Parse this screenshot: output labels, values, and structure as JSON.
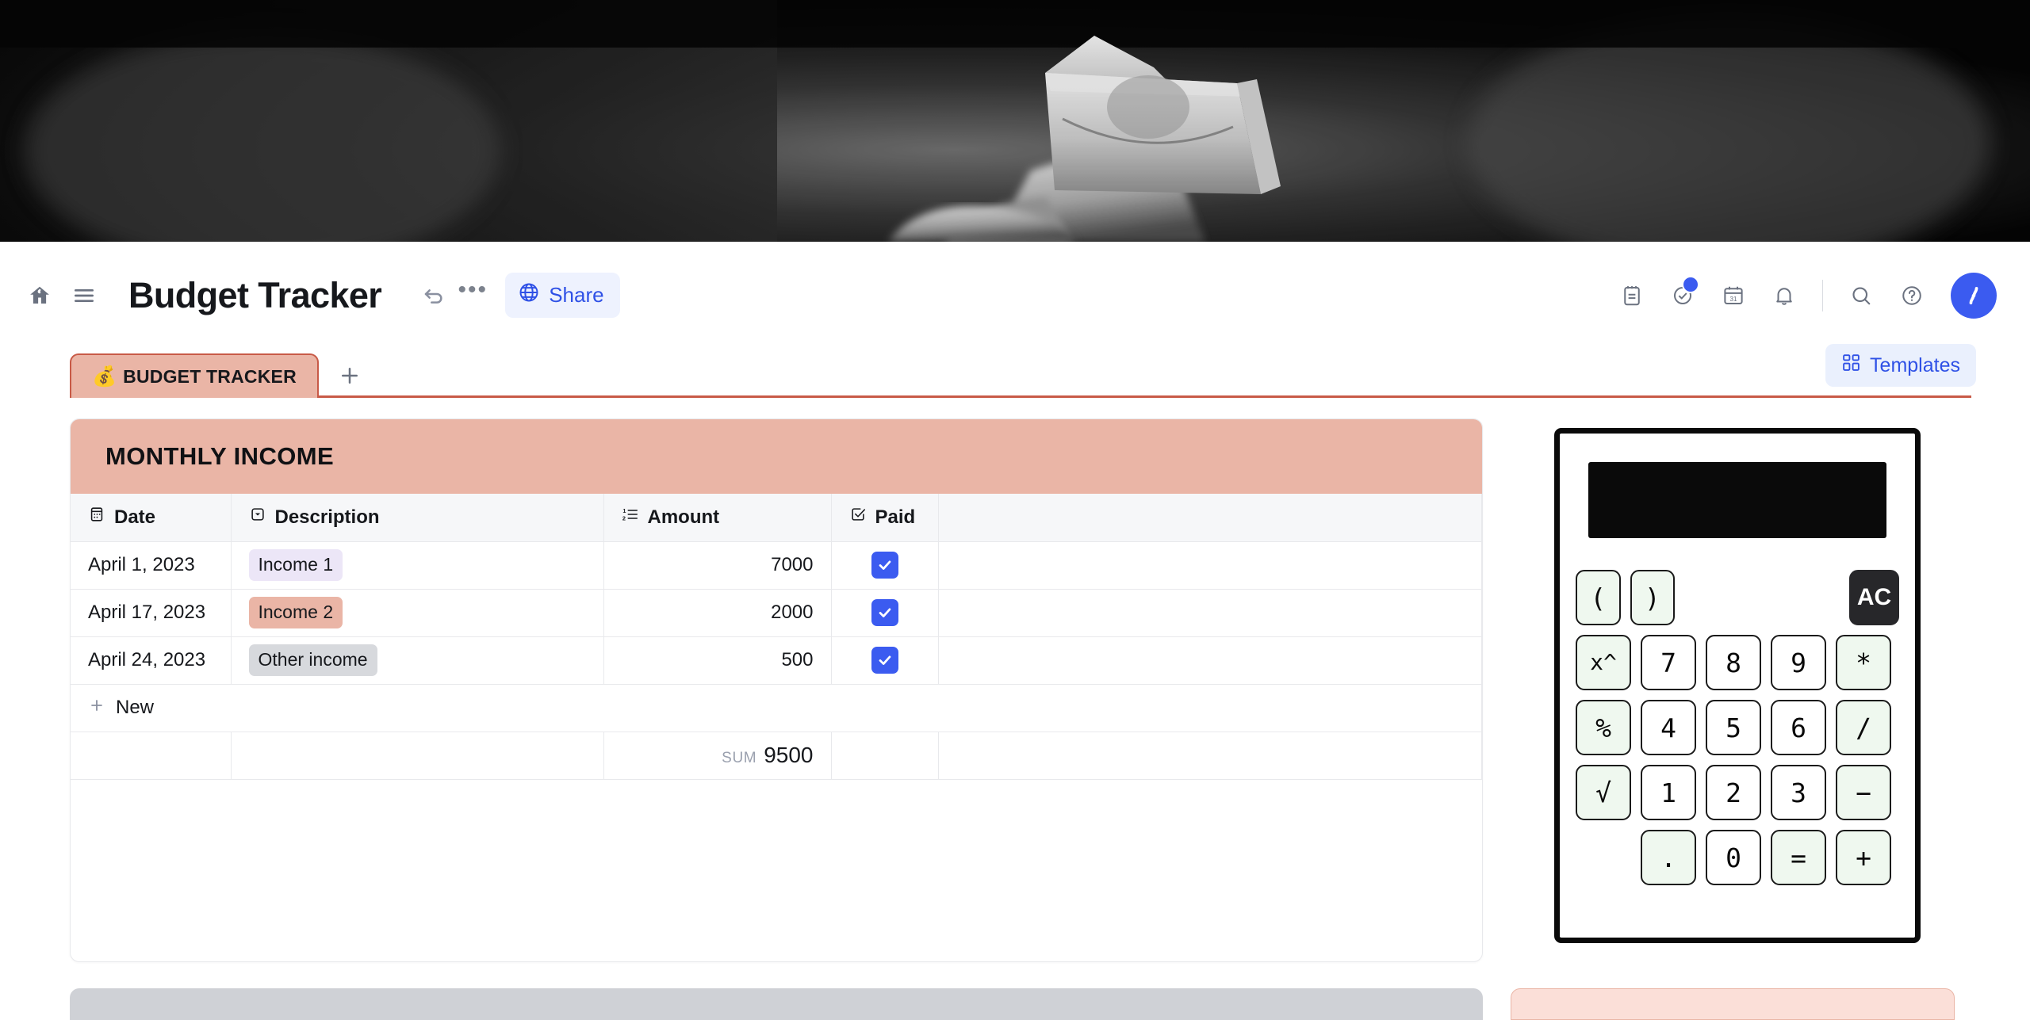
{
  "hero": {
    "alt": "hand-holding-folded-dollar-bill-black-and-white"
  },
  "header": {
    "title": "Budget Tracker",
    "home_icon": "home-icon",
    "menu_icon": "hamburger-menu-icon",
    "undo_icon": "undo-icon",
    "more_label": "•••",
    "share_label": "Share",
    "icons": [
      {
        "name": "notepad-icon",
        "badge": false
      },
      {
        "name": "check-circle-icon",
        "badge": true
      },
      {
        "name": "calendar-icon",
        "badge": false,
        "day": "31"
      },
      {
        "name": "bell-icon",
        "badge": false
      },
      {
        "name": "search-icon",
        "badge": false
      },
      {
        "name": "help-circle-icon",
        "badge": false
      }
    ],
    "avatar_icon": "user-avatar-icon"
  },
  "tabs": {
    "active": {
      "emoji": "💰",
      "label": "BUDGET TRACKER"
    },
    "add_label": "+",
    "templates_label": "Templates"
  },
  "card": {
    "banner_title": "MONTHLY INCOME",
    "columns": [
      {
        "label": "Date",
        "icon": "calendar-field-icon"
      },
      {
        "label": "Description",
        "icon": "dropdown-field-icon"
      },
      {
        "label": "Amount",
        "icon": "number-field-icon"
      },
      {
        "label": "Paid",
        "icon": "checkbox-field-icon"
      }
    ],
    "rows": [
      {
        "date": "April 1, 2023",
        "description": "Income 1",
        "tag_style": "tag-lavender",
        "amount": "7000",
        "paid": true
      },
      {
        "date": "April 17, 2023",
        "description": "Income 2",
        "tag_style": "tag-salmon",
        "amount": "2000",
        "paid": true
      },
      {
        "date": "April 24, 2023",
        "description": "Other income",
        "tag_style": "tag-gray",
        "amount": "500",
        "paid": true
      }
    ],
    "new_row_label": "New",
    "sum_label": "SUM",
    "sum_value": "9500"
  },
  "calculator": {
    "display_value": "",
    "rows": [
      [
        {
          "label": "(",
          "style": "op"
        },
        {
          "label": ")",
          "style": "op"
        },
        {
          "label": "",
          "style": "spacer-wide"
        },
        {
          "label": "AC",
          "style": "ac"
        }
      ],
      [
        {
          "label": "x^",
          "style": "op small"
        },
        {
          "label": "7",
          "style": ""
        },
        {
          "label": "8",
          "style": ""
        },
        {
          "label": "9",
          "style": ""
        },
        {
          "label": "*",
          "style": "op"
        }
      ],
      [
        {
          "label": "%",
          "style": "op"
        },
        {
          "label": "4",
          "style": ""
        },
        {
          "label": "5",
          "style": ""
        },
        {
          "label": "6",
          "style": ""
        },
        {
          "label": "/",
          "style": "op"
        }
      ],
      [
        {
          "label": "√",
          "style": "op"
        },
        {
          "label": "1",
          "style": ""
        },
        {
          "label": "2",
          "style": ""
        },
        {
          "label": "3",
          "style": ""
        },
        {
          "label": "−",
          "style": "op"
        }
      ],
      [
        {
          "label": "",
          "style": "spacer-one"
        },
        {
          "label": ".",
          "style": "op"
        },
        {
          "label": "0",
          "style": ""
        },
        {
          "label": "=",
          "style": "op"
        },
        {
          "label": "+",
          "style": "op"
        }
      ]
    ]
  },
  "colors": {
    "accent_blue": "#3b5bf0",
    "banner_salmon": "#eab5a6",
    "tab_border": "#c85a47",
    "key_mint": "#eff8ef",
    "header_gray": "#f6f7f9"
  }
}
